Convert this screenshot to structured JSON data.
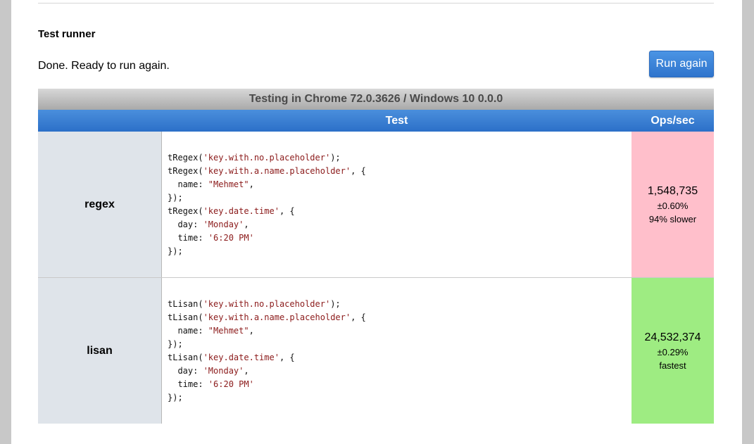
{
  "header": {
    "title": "Test runner"
  },
  "status": {
    "text": "Done. Ready to run again."
  },
  "run_button": {
    "label": "Run again"
  },
  "results": {
    "caption": "Testing in Chrome 72.0.3626 / Windows 10 0.0.0",
    "columns": {
      "test": "Test",
      "ops": "Ops/sec"
    },
    "rows": [
      {
        "title": "regex",
        "code_lines": [
          [
            "tRegex(",
            "'key.with.no.placeholder'",
            ");"
          ],
          [
            "tRegex(",
            "'key.with.a.name.placeholder'",
            ", {"
          ],
          [
            "  name: ",
            "\"Mehmet\"",
            ","
          ],
          [
            "});",
            "",
            ""
          ],
          [
            "tRegex(",
            "'key.date.time'",
            ", {"
          ],
          [
            "  day: ",
            "'Monday'",
            ","
          ],
          [
            "  time: ",
            "'6:20 PM'",
            ""
          ],
          [
            "});",
            "",
            ""
          ]
        ],
        "ops": "1,548,735",
        "rme": "±0.60%",
        "rank": "94% slower",
        "result_color": "#ffbfcb"
      },
      {
        "title": "lisan",
        "code_lines": [
          [
            "tLisan(",
            "'key.with.no.placeholder'",
            ");"
          ],
          [
            "tLisan(",
            "'key.with.a.name.placeholder'",
            ", {"
          ],
          [
            "  name: ",
            "\"Mehmet\"",
            ","
          ],
          [
            "});",
            "",
            ""
          ],
          [
            "tLisan(",
            "'key.date.time'",
            ", {"
          ],
          [
            "  day: ",
            "'Monday'",
            ","
          ],
          [
            "  time: ",
            "'6:20 PM'",
            ""
          ],
          [
            "});",
            "",
            ""
          ]
        ],
        "ops": "24,532,374",
        "rme": "±0.29%",
        "rank": "fastest",
        "result_color": "#9eec82"
      }
    ]
  }
}
